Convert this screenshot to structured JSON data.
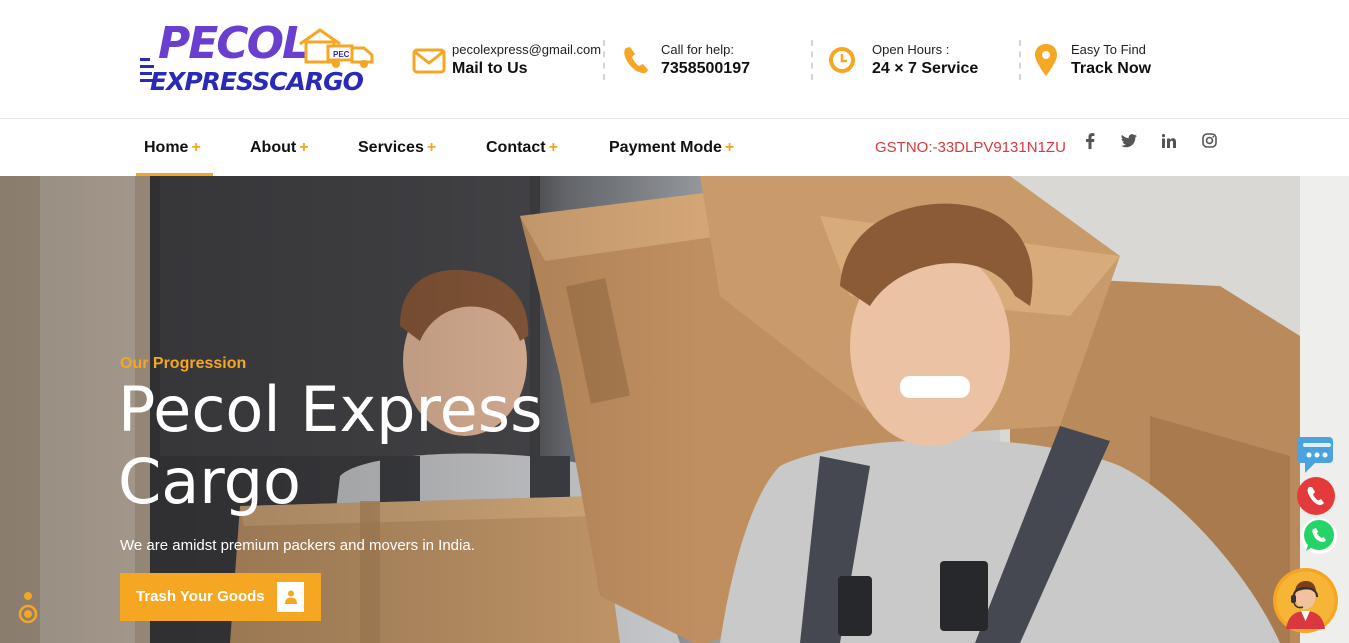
{
  "brand": {
    "logo_top": "PECOL",
    "logo_bottom": "EXPRESSCARGO",
    "logo_badge": "PEC"
  },
  "contact": [
    {
      "icon": "mail-icon",
      "line1": "pecolexpress@gmail.com",
      "line2": "Mail to Us"
    },
    {
      "icon": "phone-icon",
      "line1": "Call for help:",
      "line2": "7358500197"
    },
    {
      "icon": "clock-icon",
      "line1": "Open Hours :",
      "line2": "24 × 7 Service"
    },
    {
      "icon": "map-pin-icon",
      "line1": "Easy To Find",
      "line2": "Track Now"
    }
  ],
  "nav": {
    "items": [
      {
        "label": "Home",
        "active": true
      },
      {
        "label": "About"
      },
      {
        "label": "Services"
      },
      {
        "label": "Contact"
      },
      {
        "label": "Payment Mode"
      }
    ],
    "plus": "+",
    "gst": "GSTNO:-33DLPV9131N1ZU",
    "social": [
      "facebook-icon",
      "twitter-icon",
      "linkedin-icon",
      "instagram-icon"
    ]
  },
  "hero": {
    "kicker": "Our Progression",
    "title": "Pecol Express Cargo",
    "subtitle": "We are amidst premium packers and movers in India.",
    "cta": "Trash Your Goods"
  },
  "colors": {
    "accent": "#f5a623",
    "gst": "#d9393e",
    "logo_purple": "#6a3fd0",
    "logo_blue": "#2a2ab8"
  }
}
